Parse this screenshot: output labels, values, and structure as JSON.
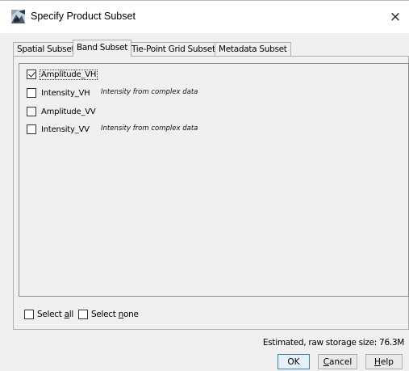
{
  "window": {
    "title": "Specify Product Subset",
    "close_glyph": "×"
  },
  "tabs": [
    {
      "label": "Spatial Subset",
      "active": false
    },
    {
      "label": "Band Subset",
      "active": true
    },
    {
      "label": "Tie-Point Grid Subset",
      "active": false
    },
    {
      "label": "Metadata Subset",
      "active": false
    }
  ],
  "bands": [
    {
      "name": "Amplitude_VH",
      "checked": true,
      "description": ""
    },
    {
      "name": "Intensity_VH",
      "checked": false,
      "description": "Intensity from complex data"
    },
    {
      "name": "Amplitude_VV",
      "checked": false,
      "description": ""
    },
    {
      "name": "Intensity_VV",
      "checked": false,
      "description": "Intensity from complex data"
    }
  ],
  "selection": {
    "select_all_pre": "Select ",
    "select_all_mn": "a",
    "select_all_post": "ll",
    "select_none_pre": "Select ",
    "select_none_mn": "n",
    "select_none_post": "one"
  },
  "storage_label": "Estimated, raw storage size: 76.3M",
  "buttons": {
    "ok": "OK",
    "cancel_mn": "C",
    "cancel_rest": "ancel",
    "help_mn": "H",
    "help_rest": "elp"
  },
  "icons": {
    "title_icon": "snap-app-icon"
  }
}
